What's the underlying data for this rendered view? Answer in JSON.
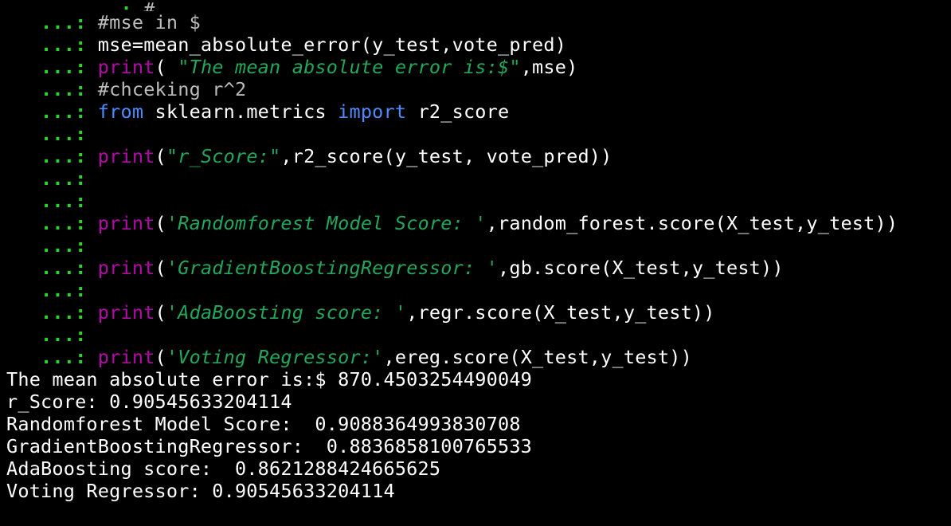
{
  "terminal": {
    "prompt": {
      "continuation": "   ...: "
    },
    "partial_top": "#",
    "code_lines": [
      [
        {
          "t": "#mse in $",
          "c": "comment"
        }
      ],
      [
        {
          "t": "mse=mean_absolute_error(y_test,vote_pred)",
          "c": "plain"
        }
      ],
      [
        {
          "t": "print",
          "c": "builtin"
        },
        {
          "t": "( ",
          "c": "plain"
        },
        {
          "t": "\"The mean absolute error is:$\"",
          "c": "string"
        },
        {
          "t": ",mse)",
          "c": "plain"
        }
      ],
      [
        {
          "t": "#chceking r^2",
          "c": "comment"
        }
      ],
      [
        {
          "t": "from",
          "c": "keyword"
        },
        {
          "t": " sklearn.metrics ",
          "c": "plain"
        },
        {
          "t": "import",
          "c": "keyword"
        },
        {
          "t": " r2_score",
          "c": "plain"
        }
      ],
      [],
      [
        {
          "t": "print",
          "c": "builtin"
        },
        {
          "t": "(",
          "c": "plain"
        },
        {
          "t": "\"r_Score:\"",
          "c": "string"
        },
        {
          "t": ",r2_score(y_test, vote_pred))",
          "c": "plain"
        }
      ],
      [],
      [],
      [
        {
          "t": "print",
          "c": "builtin"
        },
        {
          "t": "(",
          "c": "plain"
        },
        {
          "t": "'Randomforest Model Score: '",
          "c": "string"
        },
        {
          "t": ",random_forest.score(X_test,y_test))",
          "c": "plain"
        }
      ],
      [],
      [
        {
          "t": "print",
          "c": "builtin"
        },
        {
          "t": "(",
          "c": "plain"
        },
        {
          "t": "'GradientBoostingRegressor: '",
          "c": "string"
        },
        {
          "t": ",gb.score(X_test,y_test))",
          "c": "plain"
        }
      ],
      [],
      [
        {
          "t": "print",
          "c": "builtin"
        },
        {
          "t": "(",
          "c": "plain"
        },
        {
          "t": "'AdaBoosting score: '",
          "c": "string"
        },
        {
          "t": ",regr.score(X_test,y_test))",
          "c": "plain"
        }
      ],
      [],
      [
        {
          "t": "print",
          "c": "builtin"
        },
        {
          "t": "(",
          "c": "plain"
        },
        {
          "t": "'Voting Regressor:'",
          "c": "string"
        },
        {
          "t": ",ereg.score(X_test,y_test))",
          "c": "plain"
        }
      ]
    ],
    "output_lines": [
      "The mean absolute error is:$ 870.4503254490049",
      "r_Score: 0.90545633204114",
      "Randomforest Model Score:  0.9088364993830708",
      "GradientBoostingRegressor:  0.8836858100765533",
      "AdaBoosting score:  0.8621288424665625",
      "Voting Regressor: 0.90545633204114"
    ]
  },
  "colors": {
    "background": "#000000",
    "continuation_prompt": "#2bd42b",
    "builtin": "#b50aa8",
    "keyword": "#4d8cff",
    "string": "#23a75a",
    "comment": "#bcbcbc",
    "text": "#ffffff"
  }
}
